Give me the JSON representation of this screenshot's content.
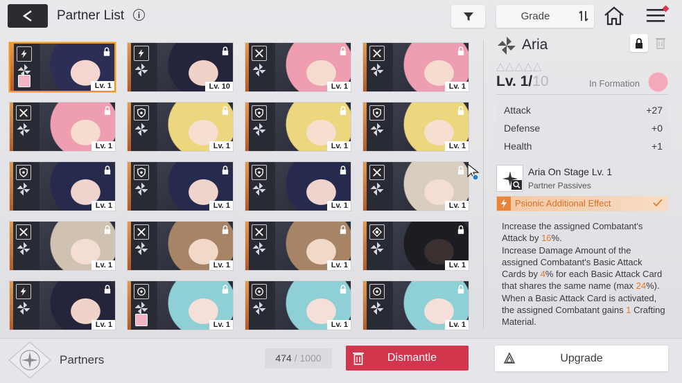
{
  "header": {
    "title": "Partner List",
    "info_icon": "info-icon",
    "sort_label": "Grade"
  },
  "cards": [
    {
      "level": "Lv. 1",
      "class_icon": "bolt-icon",
      "hair": "#2b2f55",
      "skin": "#f3d6cf",
      "selected": true,
      "mini_badge": true
    },
    {
      "level": "Lv. 10",
      "class_icon": "bolt-icon",
      "hair": "#24243a",
      "skin": "#efd3c8",
      "selected": false,
      "mini_badge": false
    },
    {
      "level": "Lv. 1",
      "class_icon": "crossed-swords-icon",
      "hair": "#ee9eb0",
      "skin": "#f6dccf",
      "selected": false,
      "mini_badge": false
    },
    {
      "level": "Lv. 1",
      "class_icon": "crossed-swords-icon",
      "hair": "#ee9eb0",
      "skin": "#f6dccf",
      "selected": false,
      "mini_badge": false
    },
    {
      "level": "Lv. 1",
      "class_icon": "crossed-swords-icon",
      "hair": "#ee9eb0",
      "skin": "#f6dccf",
      "selected": false,
      "mini_badge": false
    },
    {
      "level": "Lv. 1",
      "class_icon": "shield-icon",
      "hair": "#ecd67e",
      "skin": "#f6dfcf",
      "selected": false,
      "mini_badge": false
    },
    {
      "level": "Lv. 1",
      "class_icon": "shield-icon",
      "hair": "#ecd67e",
      "skin": "#f6dfcf",
      "selected": false,
      "mini_badge": false
    },
    {
      "level": "Lv. 1",
      "class_icon": "shield-icon",
      "hair": "#ecd67e",
      "skin": "#f6dfcf",
      "selected": false,
      "mini_badge": false
    },
    {
      "level": "Lv. 1",
      "class_icon": "shield-icon",
      "hair": "#262a4c",
      "skin": "#eed4cc",
      "selected": false,
      "mini_badge": false
    },
    {
      "level": "Lv. 1",
      "class_icon": "shield-icon",
      "hair": "#262a4c",
      "skin": "#eed4cc",
      "selected": false,
      "mini_badge": false
    },
    {
      "level": "Lv. 1",
      "class_icon": "shield-icon",
      "hair": "#262a4c",
      "skin": "#eed4cc",
      "selected": false,
      "mini_badge": false
    },
    {
      "level": "Lv. 1",
      "class_icon": "crossed-swords-icon",
      "hair": "#d8cdbf",
      "skin": "#f4ddd2",
      "selected": false,
      "mini_badge": false
    },
    {
      "level": "Lv. 1",
      "class_icon": "crossed-swords-icon",
      "hair": "#cfc2b0",
      "skin": "#f4ddd2",
      "selected": false,
      "mini_badge": false
    },
    {
      "level": "Lv. 1",
      "class_icon": "crossed-swords-icon",
      "hair": "#a88466",
      "skin": "#f2d8c6",
      "selected": false,
      "mini_badge": false
    },
    {
      "level": "Lv. 1",
      "class_icon": "crossed-swords-icon",
      "hair": "#a88466",
      "skin": "#f2d8c6",
      "selected": false,
      "mini_badge": false
    },
    {
      "level": "Lv. 1",
      "class_icon": "target-icon",
      "hair": "#1c1c22",
      "skin": "#3a3030",
      "selected": false,
      "mini_badge": false
    },
    {
      "level": "Lv. 1",
      "class_icon": "bolt-icon",
      "hair": "#24243a",
      "skin": "#efd3c8",
      "selected": false,
      "mini_badge": false
    },
    {
      "level": "Lv. 1",
      "class_icon": "circle-dot-icon",
      "hair": "#8fd0d6",
      "skin": "#f4e0d8",
      "selected": false,
      "mini_badge": true
    },
    {
      "level": "Lv. 1",
      "class_icon": "circle-dot-icon",
      "hair": "#8fd0d6",
      "skin": "#f4e0d8",
      "selected": false,
      "mini_badge": false
    },
    {
      "level": "Lv. 1",
      "class_icon": "circle-dot-icon",
      "hair": "#8fd0d6",
      "skin": "#f4e0d8",
      "selected": false,
      "mini_badge": false
    }
  ],
  "detail": {
    "name": "Aria",
    "stars": "△△△△△",
    "level": "Lv. 1/",
    "level_max": "10",
    "formation_label": "In Formation",
    "stats": [
      {
        "key": "Attack",
        "value": "+27"
      },
      {
        "key": "Defense",
        "value": "+0"
      },
      {
        "key": "Health",
        "value": "+1"
      }
    ],
    "passive_name": "Aria On Stage Lv. 1",
    "passive_type": "Partner Passives",
    "psionic_label": "Psionic Additional Effect",
    "description": [
      {
        "t": "Increase the assigned Combatant's Attack by "
      },
      {
        "t": "16",
        "hl": true
      },
      {
        "t": "%."
      },
      {
        "t": "\nIncrease Damage Amount of the assigned Combatant's Basic Attack Cards by "
      },
      {
        "t": "4",
        "hl": true
      },
      {
        "t": "% for each Basic Attack Card that shares the same name (max "
      },
      {
        "t": "24",
        "hl": true
      },
      {
        "t": "%)."
      },
      {
        "t": "\nWhen a Basic Attack Card is activated, the assigned Combatant gains "
      },
      {
        "t": "1",
        "hl": true
      },
      {
        "t": " Crafting Material."
      }
    ]
  },
  "footer": {
    "partners_label": "Partners",
    "count": "474",
    "count_sep": " / ",
    "capacity": "1000",
    "dismantle_label": "Dismantle",
    "upgrade_label": "Upgrade"
  },
  "colors": {
    "accent_red": "#d1364d",
    "psionic_orange": "#e07a2c",
    "selected_border": "#e89a2d"
  }
}
